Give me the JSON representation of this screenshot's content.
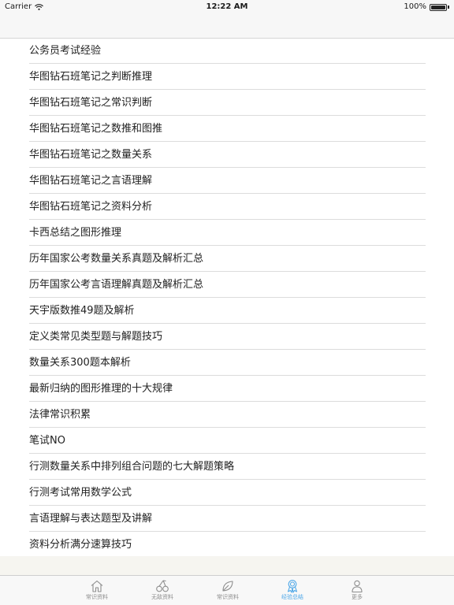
{
  "status_bar": {
    "carrier": "Carrier",
    "time": "12:22 AM",
    "battery": "100%",
    "battery_level": 1.0
  },
  "list": {
    "items": [
      "公务员考试经验",
      "华图钻石班笔记之判断推理",
      "华图钻石班笔记之常识判断",
      "华图钻石班笔记之数推和图推",
      "华图钻石班笔记之数量关系",
      "华图钻石班笔记之言语理解",
      "华图钻石班笔记之资料分析",
      "卡西总结之图形推理",
      "历年国家公考数量关系真题及解析汇总",
      "历年国家公考言语理解真题及解析汇总",
      "天宇版数推49题及解析",
      "定义类常见类型题与解题技巧",
      "数量关系300题本解析",
      "最新归纳的图形推理的十大规律",
      "法律常识积累",
      "笔试NO",
      "行测数量关系中排列组合问题的七大解题策略",
      "行测考试常用数学公式",
      "言语理解与表达题型及讲解",
      "资料分析满分速算技巧"
    ]
  },
  "tab_bar": {
    "tabs": [
      {
        "label": "常识资料",
        "icon": "home-icon",
        "active": false
      },
      {
        "label": "无敌资料",
        "icon": "cherry-icon",
        "active": false
      },
      {
        "label": "常识资料",
        "icon": "leaf-icon",
        "active": false
      },
      {
        "label": "经验总结",
        "icon": "award-icon",
        "active": true
      },
      {
        "label": "更多",
        "icon": "person-icon",
        "active": false
      }
    ]
  },
  "colors": {
    "active_tab": "#4fa8e8",
    "inactive_tab": "#8e8e8e",
    "separator": "#dcdcdc"
  }
}
